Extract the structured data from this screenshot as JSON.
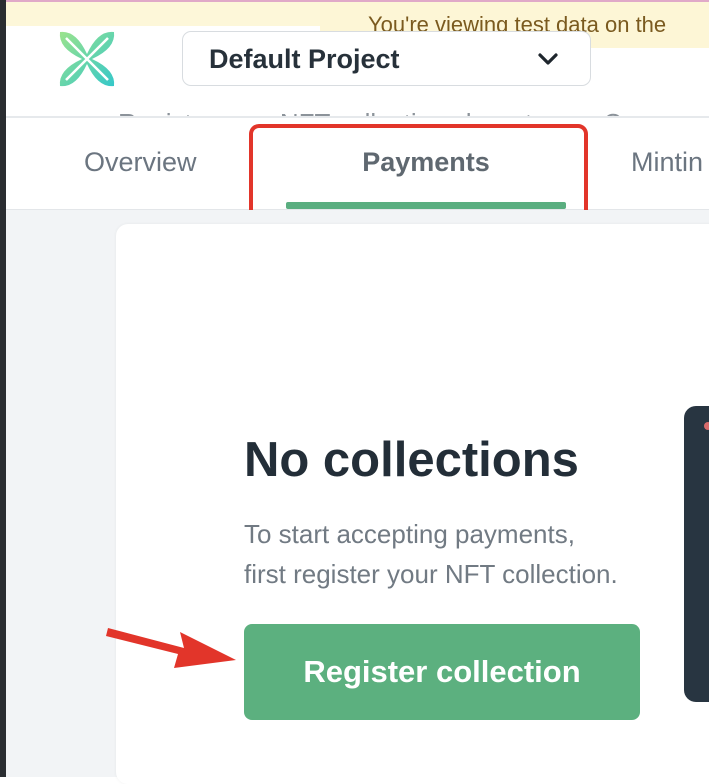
{
  "banner": {
    "text": "You're viewing test data on the"
  },
  "header": {
    "logo_icon": "brand-logo-icon",
    "project_select": {
      "value": "Default Project",
      "icon": "chevron-down-icon"
    }
  },
  "subtitle_partial": "Register your NFT collections here to use Cr",
  "tabs": [
    {
      "label": "Overview",
      "active": false
    },
    {
      "label": "Payments",
      "active": true
    },
    {
      "label": "Mintin",
      "active": false
    }
  ],
  "empty_state": {
    "title": "No collections",
    "description_line1": "To start accepting payments,",
    "description_line2": "first register your NFT collection.",
    "button_label": "Register collection"
  },
  "colors": {
    "accent": "#5cb07f",
    "annotation": "#e2352a",
    "banner_bg": "#fdf6d6",
    "title_text": "#232e38"
  }
}
